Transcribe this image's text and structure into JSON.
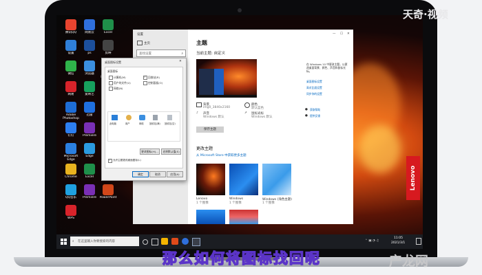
{
  "watermark": {
    "top_right": "天奇·视频",
    "bottom_right": "产龙网"
  },
  "subtitle": "那么如何将图标找回呢",
  "brand": {
    "laptop": "Lenovo"
  },
  "colors": {
    "accent": "#0067c0",
    "lenovo_red": "#d7191f",
    "subtitle_outline": "#5b34c8"
  },
  "desktop": {
    "icons": [
      {
        "label": "腾讯QQ"
      },
      {
        "label": "网易云"
      },
      {
        "label": "Excel"
      },
      {
        "label": "设置"
      },
      {
        "label": "ps"
      },
      {
        "label": "剪映"
      },
      {
        "label": "微信"
      },
      {
        "label": "浏览器"
      },
      {
        "label": "Adobe Illustrator"
      },
      {
        "label": "网易"
      },
      {
        "label": "爱奇艺"
      },
      {
        "label": "QQ"
      },
      {
        "label": "Adobe Photoshop"
      },
      {
        "label": "迅雷"
      },
      {
        "label": "微信"
      },
      {
        "label": "钉钉"
      },
      {
        "label": "Premiere"
      },
      {
        "label": "QQ音乐"
      },
      {
        "label": "Microsoft Edge"
      },
      {
        "label": "Edge"
      },
      {
        "label": "Word"
      },
      {
        "label": "Chrome"
      },
      {
        "label": "Excel"
      },
      {
        "label": "游戏"
      },
      {
        "label": "QQ音乐"
      },
      {
        "label": "Premiere"
      },
      {
        "label": "PowerPoint"
      },
      {
        "label": "WPS"
      }
    ]
  },
  "settings": {
    "title": "设置",
    "nav": {
      "home": "主页",
      "search_placeholder": "查找设置"
    },
    "page_title": "主题",
    "current_theme": "当前主题: 自定义",
    "props": [
      {
        "name": "背景",
        "value": "img0_3840x2160"
      },
      {
        "name": "颜色",
        "value": "默认蓝色"
      },
      {
        "name": "声音",
        "value": "Windows 默认"
      },
      {
        "name": "鼠标光标",
        "value": "Windows 默认"
      }
    ],
    "save_button": "保存主题",
    "change_section": "更改主题",
    "store_link": "从 Microsoft Store 中获取更多主题",
    "themes": [
      {
        "name": "Lenovo",
        "count": "1 个图像"
      },
      {
        "name": "Windows",
        "count": "1 个图像"
      },
      {
        "name": "Windows (浅色主题)",
        "count": "1 个图像"
      }
    ],
    "right_panel": {
      "text": "在 Windows 10 中更改主题，以更改桌面背景、颜色、声音和鼠标光标。",
      "links": [
        "桌面图标设置",
        "高对比度设置",
        "同步你的设置"
      ],
      "help": [
        "获取帮助",
        "提供反馈"
      ]
    }
  },
  "dialog": {
    "title": "桌面图标设置",
    "section_label": "桌面图标",
    "checkboxes": [
      {
        "label": "计算机(M)",
        "checked": false
      },
      {
        "label": "回收站(R)",
        "checked": true
      },
      {
        "label": "用户的文件(U)",
        "checked": false
      },
      {
        "label": "控制面板(O)",
        "checked": false
      },
      {
        "label": "网络(N)",
        "checked": false
      }
    ],
    "icons": [
      "此电脑",
      "用户",
      "网络",
      "回收站(满)",
      "回收站(空)"
    ],
    "change_icon_button": "更改图标(H)...",
    "restore_button": "还原默认值(S)",
    "allow_themes": "允许主题更改桌面图标(L)",
    "ok": "确定",
    "cancel": "取消",
    "apply": "应用(A)"
  },
  "taskbar": {
    "search_placeholder": "在这里输入你要搜索的内容",
    "time": "11:05",
    "date": "2021/3/1"
  }
}
